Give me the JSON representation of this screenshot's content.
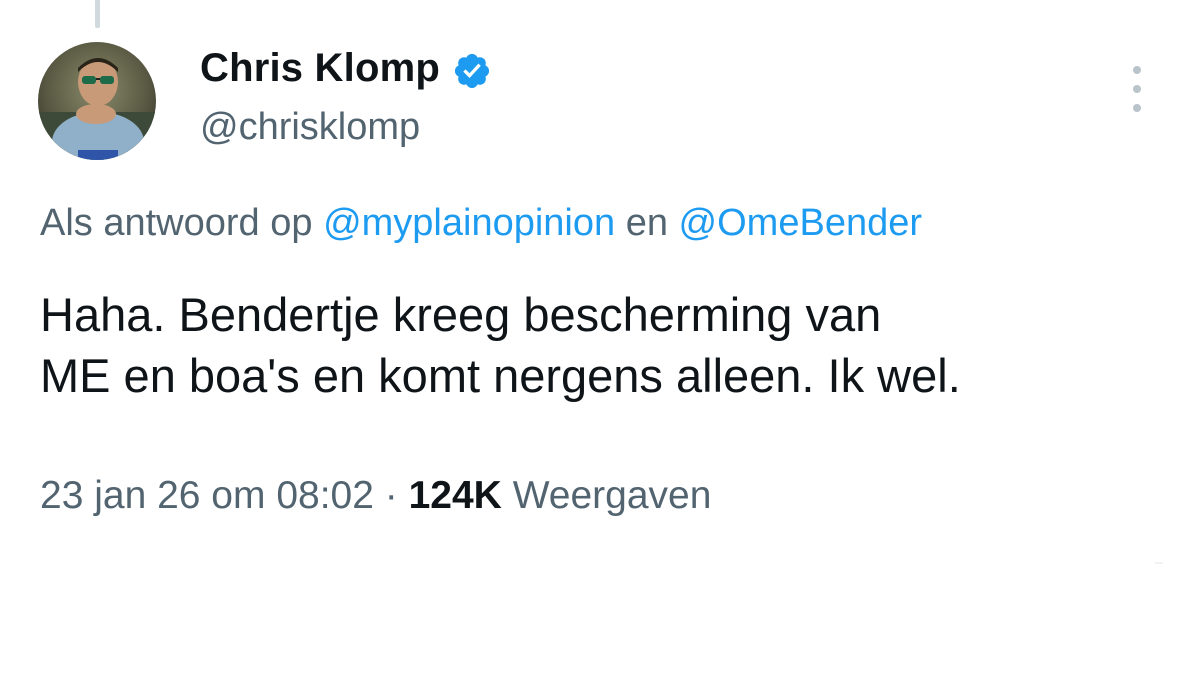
{
  "tweet": {
    "author": {
      "display_name": "Chris Klomp",
      "handle": "@chrisklomp",
      "verified_icon": "verified-badge-icon",
      "avatar_icon": "profile-photo"
    },
    "reply_to": {
      "prefix": "Als antwoord op",
      "mentions": [
        "@myplainopinion",
        "@OmeBender"
      ],
      "joiner": "en"
    },
    "text_lines": [
      "Haha. Bendertje kreeg bescherming van",
      "ME en boa's en komt nergens alleen. Ik wel."
    ],
    "timestamp": "23 jan 26 om 08:02",
    "separator": "·",
    "views_count": "124K",
    "views_label": "Weergaven",
    "more_icon": "more-vertical-icon"
  },
  "colors": {
    "text_primary": "#0f1419",
    "text_secondary": "#536471",
    "link": "#1d9bf0",
    "verified": "#1d9bf0"
  }
}
